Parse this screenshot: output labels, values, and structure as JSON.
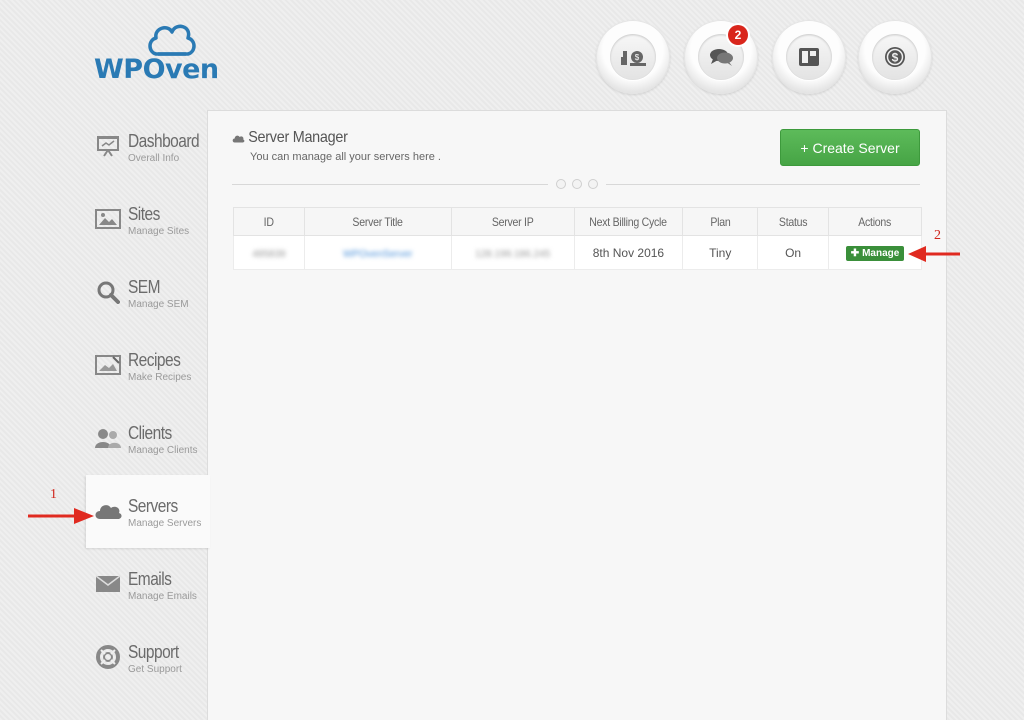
{
  "brand": {
    "logo_text": "WPOven",
    "logo_color": "#2a7ab4"
  },
  "top_icons": [
    {
      "name": "billing-icon"
    },
    {
      "name": "messages-icon",
      "badge": "2"
    },
    {
      "name": "layout-icon"
    },
    {
      "name": "dollar-icon"
    }
  ],
  "sidebar": {
    "items": [
      {
        "label": "Dashboard",
        "sub": "Overall Info"
      },
      {
        "label": "Sites",
        "sub": "Manage Sites"
      },
      {
        "label": "SEM",
        "sub": "Manage SEM"
      },
      {
        "label": "Recipes",
        "sub": "Make Recipes"
      },
      {
        "label": "Clients",
        "sub": "Manage Clients"
      },
      {
        "label": "Servers",
        "sub": "Manage Servers",
        "active": true
      },
      {
        "label": "Emails",
        "sub": "Manage Emails"
      },
      {
        "label": "Support",
        "sub": "Get Support"
      }
    ]
  },
  "panel": {
    "title": "Server Manager",
    "subtitle": "You can manage all your servers here .",
    "create_button": "+ Create Server"
  },
  "table": {
    "headers": [
      "ID",
      "Server Title",
      "Server IP",
      "Next Billing Cycle",
      "Plan",
      "Status",
      "Actions"
    ],
    "rows": [
      {
        "id": "485839",
        "title": "WPOvenServer",
        "ip": "128.199.186.245",
        "billing": "8th Nov 2016",
        "plan": "Tiny",
        "status": "On",
        "action": "Manage"
      }
    ]
  },
  "annotations": {
    "one": "1",
    "two": "2",
    "color": "#d0251c"
  },
  "colors": {
    "accent_green": "#46a445",
    "badge_red": "#d9261c"
  }
}
